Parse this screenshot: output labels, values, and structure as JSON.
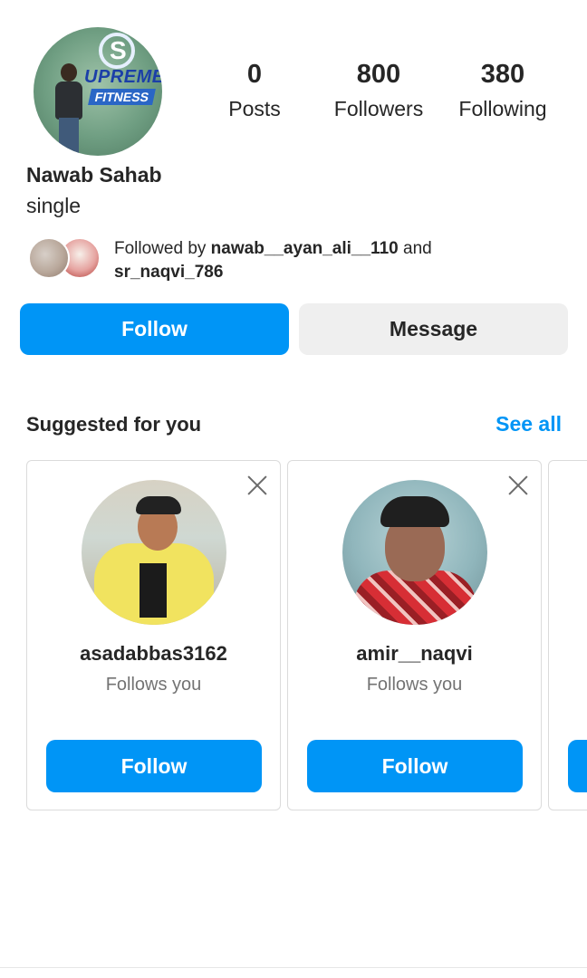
{
  "profile": {
    "name": "Nawab Sahab",
    "bio": "single",
    "stats": {
      "posts_value": "0",
      "posts_label": "Posts",
      "followers_value": "800",
      "followers_label": "Followers",
      "following_value": "380",
      "following_label": "Following"
    },
    "followed_by": {
      "prefix": "Followed by ",
      "user1": "nawab__ayan_ali__110",
      "and": " and",
      "user2": "sr_naqvi_786"
    },
    "actions": {
      "follow": "Follow",
      "message": "Message"
    }
  },
  "suggested": {
    "title": "Suggested for you",
    "see_all": "See all",
    "cards": [
      {
        "username": "asadabbas3162",
        "subtitle": "Follows you",
        "button": "Follow"
      },
      {
        "username": "amir__naqvi",
        "subtitle": "Follows you",
        "button": "Follow"
      }
    ]
  },
  "colors": {
    "primary_blue": "#0095f6",
    "secondary_gray": "#efefef",
    "text_primary": "#262626",
    "text_secondary": "#737373"
  },
  "icons": {
    "close": "close-icon"
  }
}
